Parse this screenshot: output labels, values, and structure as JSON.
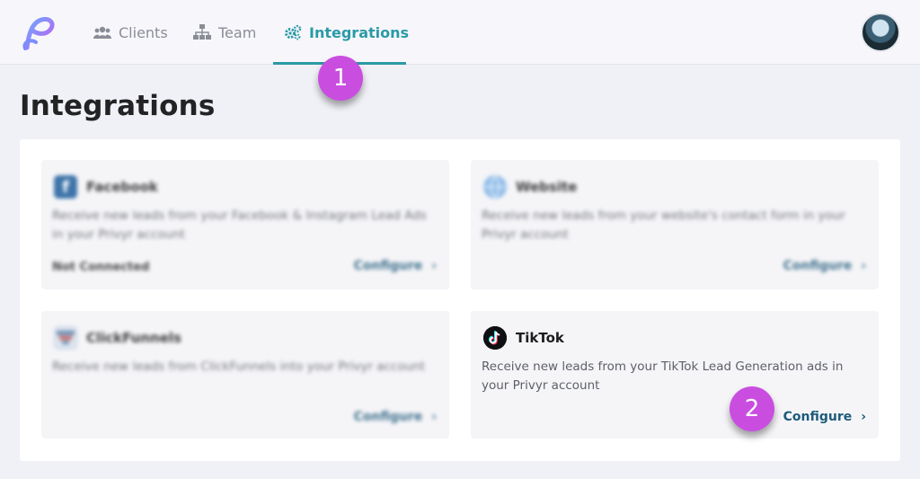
{
  "nav": {
    "tabs": [
      {
        "label": "Clients",
        "icon": "users-icon"
      },
      {
        "label": "Team",
        "icon": "org-chart-icon"
      },
      {
        "label": "Integrations",
        "icon": "gears-icon",
        "active": true
      }
    ]
  },
  "page": {
    "title": "Integrations"
  },
  "integrations": [
    {
      "name": "Facebook",
      "desc": "Receive new leads from your Facebook & Instagram Lead Ads in your Privyr account",
      "status": "Not Connected",
      "action": "Configure",
      "blurred": true
    },
    {
      "name": "Website",
      "desc": "Receive new leads from your website's contact form in your Privyr account",
      "action": "Configure",
      "blurred": true
    },
    {
      "name": "ClickFunnels",
      "desc": "Receive new leads from ClickFunnels into your Privyr account",
      "action": "Configure",
      "blurred": true
    },
    {
      "name": "TikTok",
      "desc": "Receive new leads from your TikTok Lead Generation ads in your Privyr account",
      "action": "Configure",
      "blurred": false
    }
  ],
  "annotations": {
    "step1": "1",
    "step2": "2"
  },
  "colors": {
    "accent": "#2a9aa6",
    "marker": "#c94ee0",
    "link": "#1f5a7a"
  }
}
